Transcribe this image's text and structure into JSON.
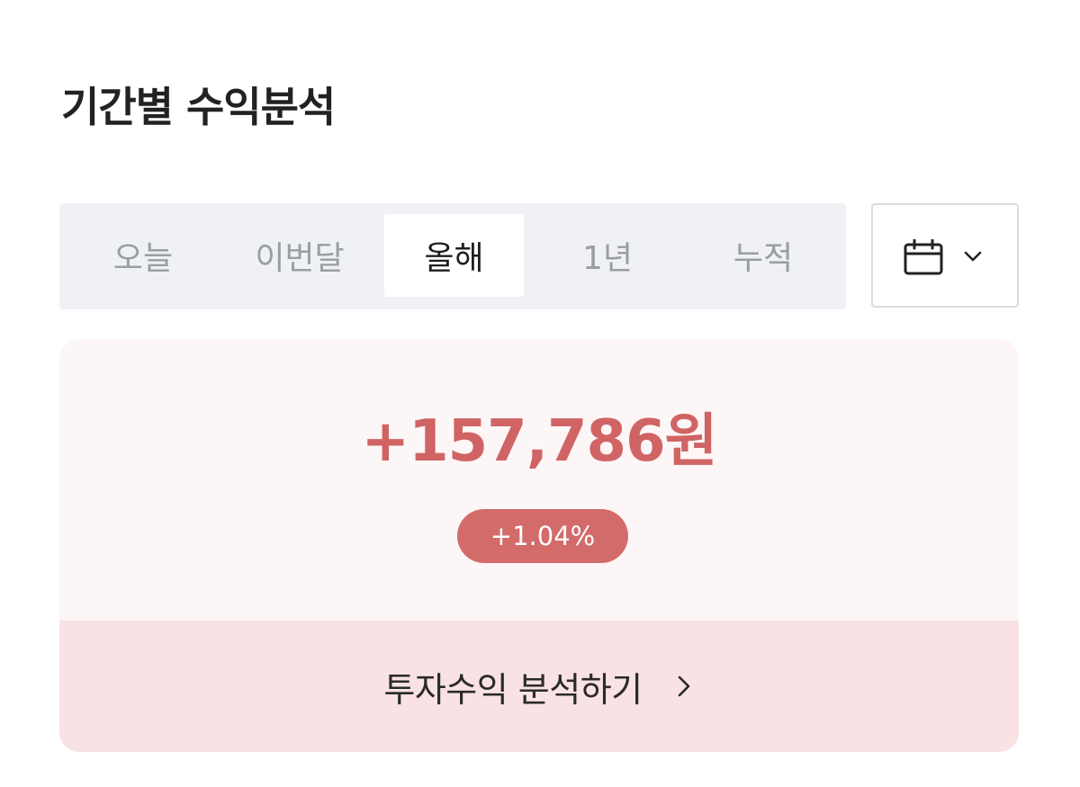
{
  "header": {
    "title": "기간별 수익분석"
  },
  "period_tabs": [
    {
      "label": "오늘",
      "active": false
    },
    {
      "label": "이번달",
      "active": false
    },
    {
      "label": "올해",
      "active": true
    },
    {
      "label": "1년",
      "active": false
    },
    {
      "label": "누적",
      "active": false
    }
  ],
  "date_picker": {
    "icon": "calendar-icon",
    "dropdown_icon": "chevron-down-icon"
  },
  "summary": {
    "amount": "+157,786원",
    "percent": "+1.04%"
  },
  "footer": {
    "label": "투자수익 분석하기",
    "icon": "chevron-right-icon"
  },
  "colors": {
    "positive": "#d06465",
    "badge_bg": "#d36b6b",
    "card_bg": "#fdf6f6",
    "footer_bg": "#f9e2e3",
    "segment_bg": "#eff1f4"
  }
}
